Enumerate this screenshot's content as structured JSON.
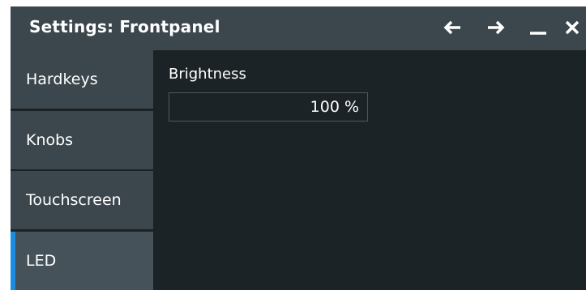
{
  "window": {
    "title": "Settings: Frontpanel",
    "buttons": [
      {
        "name": "back-button",
        "icon": "arrow-left-icon"
      },
      {
        "name": "forward-button",
        "icon": "arrow-right-icon"
      },
      {
        "name": "minimize-button",
        "icon": "minimize-icon"
      },
      {
        "name": "close-button",
        "icon": "close-icon"
      }
    ]
  },
  "sidebar": {
    "items": [
      {
        "label": "Hardkeys",
        "active": false
      },
      {
        "label": "Knobs",
        "active": false
      },
      {
        "label": "Touchscreen",
        "active": false
      },
      {
        "label": "LED",
        "active": true
      }
    ]
  },
  "content": {
    "brightness": {
      "label": "Brightness",
      "value": "100 %"
    }
  },
  "colors": {
    "titlebar": "#3b474d",
    "background": "#1c2326",
    "active_indicator": "#1c8ce0"
  }
}
